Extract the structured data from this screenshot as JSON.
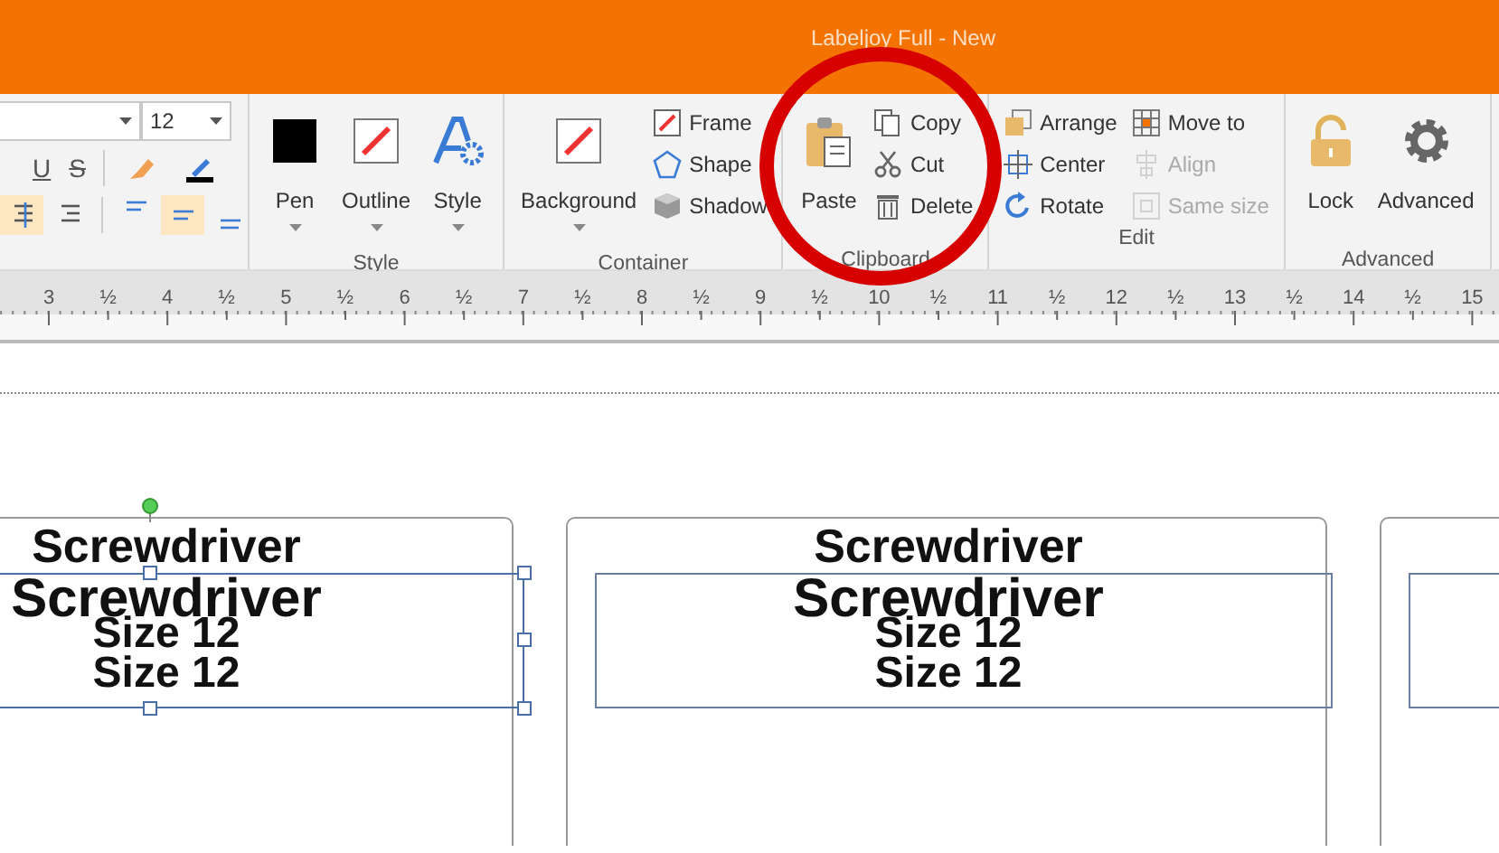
{
  "window": {
    "title": "Labeljoy Full - New"
  },
  "format": {
    "font_size": "12",
    "text_buttons": [
      {
        "label": "U"
      },
      {
        "label": "S"
      }
    ],
    "align_buttons": [
      {
        "selected": true
      },
      {
        "selected": false
      },
      {
        "selected": false
      },
      {
        "selected": true
      },
      {
        "selected": false
      }
    ]
  },
  "groups": [
    {
      "label": "Style",
      "items": [
        {
          "kind": "large",
          "label": "Pen",
          "dropdown": true
        },
        {
          "kind": "large",
          "label": "Outline",
          "dropdown": true
        },
        {
          "kind": "large",
          "label": "Style",
          "dropdown": true
        }
      ]
    },
    {
      "label": "Container",
      "items": [
        {
          "kind": "large",
          "label": "Background",
          "dropdown": true
        },
        {
          "kind": "small",
          "label": "Frame",
          "disabled": false
        },
        {
          "kind": "small",
          "label": "Shape",
          "disabled": false
        },
        {
          "kind": "small",
          "label": "Shadow",
          "disabled": false
        }
      ]
    },
    {
      "label": "Clipboard",
      "items": [
        {
          "kind": "large",
          "label": "Paste",
          "dropdown": false
        },
        {
          "kind": "small",
          "label": "Copy",
          "disabled": false
        },
        {
          "kind": "small",
          "label": "Cut",
          "disabled": false
        },
        {
          "kind": "small",
          "label": "Delete",
          "disabled": false
        }
      ]
    },
    {
      "label": "Edit",
      "items": [
        {
          "kind": "small",
          "label": "Arrange",
          "disabled": false
        },
        {
          "kind": "small",
          "label": "Center",
          "disabled": false
        },
        {
          "kind": "small",
          "label": "Rotate",
          "disabled": false
        },
        {
          "kind": "small",
          "label": "Move to",
          "disabled": false
        },
        {
          "kind": "small",
          "label": "Align",
          "disabled": true
        },
        {
          "kind": "small",
          "label": "Same size",
          "disabled": true
        }
      ]
    },
    {
      "label": "Advanced",
      "items": [
        {
          "kind": "large",
          "label": "Lock",
          "dropdown": false
        },
        {
          "kind": "large",
          "label": "Advanced",
          "dropdown": false
        }
      ]
    }
  ],
  "ruler": [
    "3",
    "½",
    "4",
    "½",
    "5",
    "½",
    "6",
    "½",
    "7",
    "½",
    "8",
    "½",
    "9",
    "½",
    "10",
    "½",
    "11",
    "½",
    "12",
    "½",
    "13",
    "½",
    "14",
    "½",
    "15"
  ],
  "labels": [
    {
      "selected": true,
      "lines": [
        {
          "text": "Screwdriver",
          "kind": "name"
        },
        {
          "text": "Screwdriver",
          "kind": "name-large"
        },
        {
          "text": "Size 12",
          "kind": "size"
        },
        {
          "text": "Size 12",
          "kind": "size-large"
        }
      ]
    },
    {
      "selected": false,
      "lines": [
        {
          "text": "Screwdriver",
          "kind": "name"
        },
        {
          "text": "Screwdriver",
          "kind": "name-large"
        },
        {
          "text": "Size 12",
          "kind": "size"
        },
        {
          "text": "Size 12",
          "kind": "size-large"
        }
      ]
    },
    {
      "selected": false
    }
  ]
}
